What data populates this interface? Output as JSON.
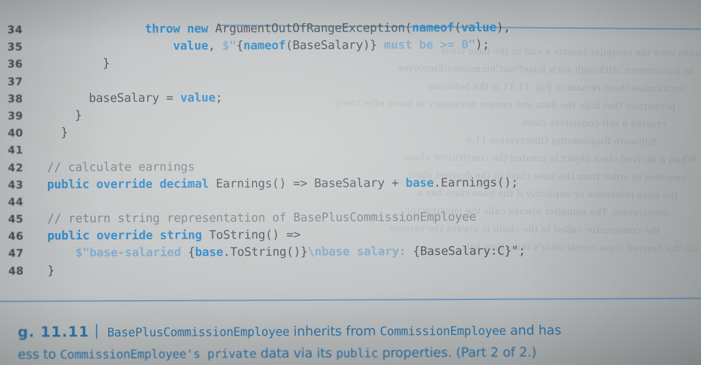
{
  "figure": {
    "number": "g. 11.11",
    "caption_line1_prefix": "BasePlusCommissionEmployee",
    "caption_line1_mid": " inherits from ",
    "caption_line1_mono2": "CommissionEmployee",
    "caption_line1_suffix": " and has",
    "caption_line2_prefix": "ess to ",
    "caption_line2_mono1": "CommissionEmployee's private",
    "caption_line2_mid": " data via its ",
    "caption_line2_mono2": "public",
    "caption_line2_suffix": " properties. (Part 2 of 2.)"
  },
  "colors": {
    "keyword": "#2d8ac9",
    "string": "#80a9cd",
    "comment": "#7b8289",
    "plain": "#4b545b",
    "rule": "#5f92bd",
    "caption": "#2f77ae",
    "paper": "#c2c5c6"
  },
  "listing": {
    "language": "csharp",
    "lines": [
      {
        "n": "34",
        "indent": 8,
        "tokens": [
          {
            "t": "throw new ",
            "c": "kw"
          },
          {
            "t": "ArgumentOutOfRangeException(",
            "c": "plain"
          },
          {
            "t": "nameof",
            "c": "kw"
          },
          {
            "t": "(",
            "c": "plain"
          },
          {
            "t": "value",
            "c": "kw"
          },
          {
            "t": "),",
            "c": "plain"
          }
        ]
      },
      {
        "n": "35",
        "indent": 10,
        "tokens": [
          {
            "t": "value",
            "c": "kw"
          },
          {
            "t": ", ",
            "c": "plain"
          },
          {
            "t": "$\"",
            "c": "str"
          },
          {
            "t": "{",
            "c": "plain"
          },
          {
            "t": "nameof",
            "c": "kw"
          },
          {
            "t": "(BaseSalary)} ",
            "c": "plain"
          },
          {
            "t": "must be >= 0\"",
            "c": "str"
          },
          {
            "t": ");",
            "c": "plain"
          }
        ]
      },
      {
        "n": "36",
        "indent": 5,
        "tokens": [
          {
            "t": "}",
            "c": "plain"
          }
        ]
      },
      {
        "n": "37",
        "indent": 0,
        "tokens": []
      },
      {
        "n": "38",
        "indent": 4,
        "tokens": [
          {
            "t": "baseSalary = ",
            "c": "plain"
          },
          {
            "t": "value",
            "c": "kw"
          },
          {
            "t": ";",
            "c": "plain"
          }
        ]
      },
      {
        "n": "39",
        "indent": 3,
        "tokens": [
          {
            "t": "}",
            "c": "plain"
          }
        ]
      },
      {
        "n": "40",
        "indent": 2,
        "tokens": [
          {
            "t": "}",
            "c": "plain"
          }
        ]
      },
      {
        "n": "41",
        "indent": 0,
        "tokens": []
      },
      {
        "n": "42",
        "indent": 1,
        "tokens": [
          {
            "t": "// calculate earnings",
            "c": "cmt"
          }
        ]
      },
      {
        "n": "43",
        "indent": 1,
        "tokens": [
          {
            "t": "public override decimal ",
            "c": "kw"
          },
          {
            "t": "Earnings() => BaseSalary + ",
            "c": "plain"
          },
          {
            "t": "base",
            "c": "kw"
          },
          {
            "t": ".Earnings();",
            "c": "plain"
          }
        ]
      },
      {
        "n": "44",
        "indent": 0,
        "tokens": []
      },
      {
        "n": "45",
        "indent": 1,
        "tokens": [
          {
            "t": "// return string representation of BasePlusCommissionEmployee",
            "c": "cmt"
          }
        ]
      },
      {
        "n": "46",
        "indent": 1,
        "tokens": [
          {
            "t": "public override string ",
            "c": "kw"
          },
          {
            "t": "ToString() =>",
            "c": "plain"
          }
        ]
      },
      {
        "n": "47",
        "indent": 3,
        "tokens": [
          {
            "t": "$\"base-salaried ",
            "c": "str"
          },
          {
            "t": "{",
            "c": "plain"
          },
          {
            "t": "base",
            "c": "kw"
          },
          {
            "t": ".ToString()}",
            "c": "plain"
          },
          {
            "t": "\\nbase salary: ",
            "c": "str"
          },
          {
            "t": "{BaseSalary:C}\"",
            "c": "plain"
          },
          {
            "t": ";",
            "c": "plain"
          }
        ]
      },
      {
        "n": "48",
        "indent": 1,
        "tokens": [
          {
            "t": "}",
            "c": "plain"
          }
        ]
      }
    ]
  },
  "showthrough": {
    "lines": [
      "sotto voce the compiler inserts a call to the base class",
      "as parameters. Although such BasePlusCommissionEmployee",
      "erchandise them remain in Fig. 11.11 is the behavior",
      "properties that hide the data and ensure necessary to leave effectively",
      "creates a self-consistent class.",
      "Software Engineering Observation 11.6",
      "When a derived class object is created the constructor chain",
      "executes in order from the base class to the derived class,",
      "the base reference or implicitly if the base class has a",
      "constructor. The compiler always calls the constructor",
      "the constructor called in the chain is always the version",
      "via the derived-class constructor's initializer list."
    ]
  }
}
